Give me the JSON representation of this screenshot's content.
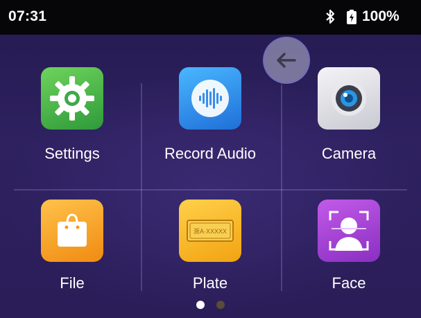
{
  "status_bar": {
    "time": "07:31",
    "battery": "100%"
  },
  "apps": [
    {
      "label": "Settings",
      "icon": "gear-icon"
    },
    {
      "label": "Record Audio",
      "icon": "audio-wave-icon"
    },
    {
      "label": "Camera",
      "icon": "camera-icon"
    },
    {
      "label": "File",
      "icon": "bag-icon"
    },
    {
      "label": "Plate",
      "icon": "license-plate-icon"
    },
    {
      "label": "Face",
      "icon": "face-scan-icon"
    }
  ],
  "plate_text": "浙A·XXXXX",
  "pager": {
    "pages": 2,
    "current": 1
  },
  "colors": {
    "settings": "#4cb04a",
    "audio": "#2a8df0",
    "camera": "#d8d8de",
    "file": "#f5a623",
    "plate": "#f6b51e",
    "face": "#a23fd1"
  }
}
